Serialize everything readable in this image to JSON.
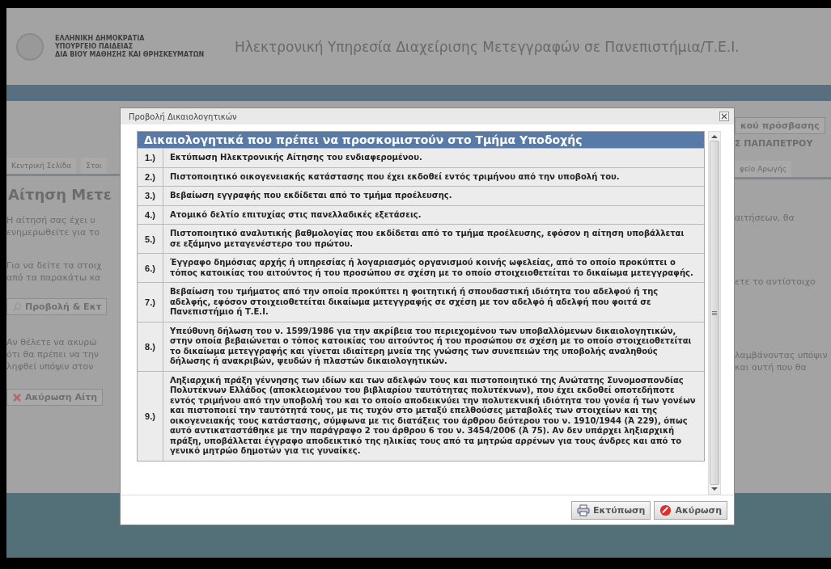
{
  "header": {
    "org_lines": [
      "ΕΛΛΗΝΙΚΗ ΔΗΜΟΚΡΑΤΙΑ",
      "ΥΠΟΥΡΓΕΙΟ ΠΑΙΔΕΙΑΣ",
      "ΔΙΑ ΒΙΟΥ ΜΑΘΗΣΗΣ ΚΑΙ ΘΡΗΣΚΕΥΜΑΤΩΝ"
    ],
    "title": "Ηλεκτρονική Υπηρεσία Διαχείρισης Μετεγγραφών σε Πανεπιστήμια/Τ.Ε.Ι."
  },
  "left_panel": {
    "tabs": [
      {
        "label": "Κεντρική Σελίδα",
        "selected": false
      },
      {
        "label": "Στοι",
        "selected": false
      }
    ],
    "page_title": "Αίτηση Μετε",
    "paragraphs": [
      [
        "Η αίτησή σας έχει υ",
        "ενημερωθείτε για το"
      ],
      [
        "Για να δείτε τα στοιχ",
        "από τα παρακάτω κα"
      ]
    ],
    "view_button": {
      "label": "Προβολή & Εκτ",
      "kind": "view"
    },
    "cancel_paragraph": [
      "Αν θέλετε να ακυρώ",
      "ότι θα πρέπει να την",
      "ληφθεί υπόψιν στον"
    ],
    "cancel_button": {
      "label": "Ακύρωση Αίτη",
      "kind": "cancel"
    }
  },
  "right_panel": {
    "access_button": "κού πρόσβασης",
    "user_name": "Σ ΠΑΠΑΠΕΤΡΟΥ",
    "tab": {
      "label": "φείο Αρωγής",
      "selected": false
    },
    "paragraphs": [
      [
        "αιτήσεων, θα"
      ],
      [
        "ετε το αντίστοιχο"
      ],
      [
        "λαμβάνοντας υπόψιν",
        "και αυτή που θα"
      ]
    ]
  },
  "dialog": {
    "title": "Προβολή Δικαιολογητικών",
    "table_title": "Δικαιολογητικά που πρέπει να προσκομιστούν στο Τμήμα Υποδοχής",
    "rows": [
      {
        "num": "1.)",
        "text": "Εκτύπωση Ηλεκτρονικής Αίτησης του ενδιαφερομένου."
      },
      {
        "num": "2.)",
        "text": "Πιστοποιητικό οικογενειακής κατάστασης που έχει εκδοθεί εντός τριμήνου από την υποβολή του."
      },
      {
        "num": "3.)",
        "text": "Βεβαίωση εγγραφής που εκδίδεται από το τμήμα προέλευσης."
      },
      {
        "num": "4.)",
        "text": "Ατομικό δελτίο επιτυχίας στις πανελλαδικές εξετάσεις."
      },
      {
        "num": "5.)",
        "text": "Πιστοποιητικό αναλυτικής βαθμολογίας που εκδίδεται από το τμήμα προέλευσης, εφόσον η αίτηση υποβάλλεται σε εξάμηνο μεταγενέστερο του πρώτου."
      },
      {
        "num": "6.)",
        "text": "Έγγραφο δημόσιας αρχής ή υπηρεσίας ή λογαριασμός οργανισμού κοινής ωφελείας, από το οποίο προκύπτει ο τόπος κατοικίας του αιτούντος ή του προσώπου σε σχέση με το οποίο στοιχειοθετείται το δικαίωμα μετεγγραφής."
      },
      {
        "num": "7.)",
        "text": "Βεβαίωση του τμήματος από την οποία προκύπτει η φοιτητική ή σπουδαστική ιδιότητα του αδελφού ή της αδελφής, εφόσον στοιχειοθετείται δικαίωμα μετεγγραφής σε σχέση με τον αδελφό ή αδελφή που φοιτά σε Πανεπιστήμιο ή Τ.Ε.Ι."
      },
      {
        "num": "8.)",
        "text": "Υπεύθυνη δήλωση του ν. 1599/1986 για την ακρίβεια του περιεχομένου των υποβαλλόμενων δικαιολογητικών, στην οποία βεβαιώνεται ο τόπος κατοικίας του αιτούντος ή του προσώπου σε σχέση με το οποίο στοιχειοθετείται το δικαίωμα μετεγγραφής και γίνεται ιδιαίτερη μνεία της γνώσης των συνεπειών της υποβολής αναληθούς δήλωσης ή ανακριβών, ψευδών ή πλαστών δικαιολογητικών."
      },
      {
        "num": "9.)",
        "text": "Ληξιαρχική πράξη γέννησης των ιδίων και των αδελφών τους και πιστοποιητικό της Ανώτατης Συνομοσπονδίας Πολυτέκνων Ελλάδος (αποκλειομένου του βιβλιαρίου ταυτότητας πολυτέκνων), που έχει εκδοθεί οποτεδήποτε εντός τριμήνου από την υποβολή του και το οποίο αποδεικνύει την πολυτεκνική ιδιότητα του γονέα ή των γονέων και πιστοποιεί την ταυτότητά τους, με τις τυχόν στο μεταξύ επελθούσες μεταβολές των στοιχείων και της οικογενειακής τους κατάστασης, σύμφωνα με τις διατάξεις του άρθρου δεύτερου του ν. 1910/1944 (Ά 229), όπως αυτό αντικαταστάθηκε με την παράγραφο 2 του άρθρου 6 του ν. 3454/2006 (Ά 75). Αν δεν υπάρχει ληξιαρχική πράξη, υποβάλλεται έγγραφο αποδεικτικό της ηλικίας τους από τα μητρώα αρρένων για τους άνδρες και από το γενικό μητρώο δημοτών για τις γυναίκες."
      }
    ],
    "buttons": [
      {
        "label": "Εκτύπωση",
        "kind": "print"
      },
      {
        "label": "Ακύρωση",
        "kind": "cancel"
      }
    ]
  }
}
